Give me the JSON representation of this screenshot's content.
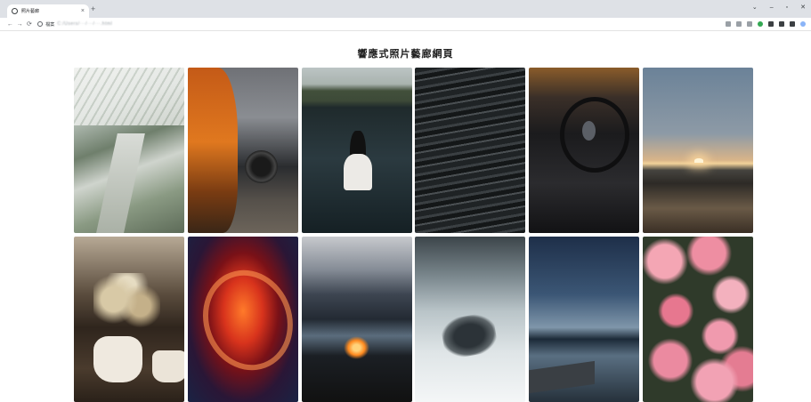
{
  "browser": {
    "tab_title": "照片藝廊",
    "tab_close": "×",
    "new_tab": "+",
    "address_label": "檔案",
    "address_url": "C:/Users/···/···/···.html"
  },
  "page": {
    "title": "響應式照片藝廊網頁"
  },
  "gallery": {
    "photos": [
      "greenhouse",
      "orange-sports-car",
      "woman-in-lake",
      "dark-water-waves",
      "car-steering-wheel",
      "desert-sunset",
      "dried-flowers-vases",
      "abstract-red-light",
      "campfire-by-lake",
      "misty-mountain-rock",
      "lake-dock-dusk",
      "pink-flowers"
    ]
  }
}
